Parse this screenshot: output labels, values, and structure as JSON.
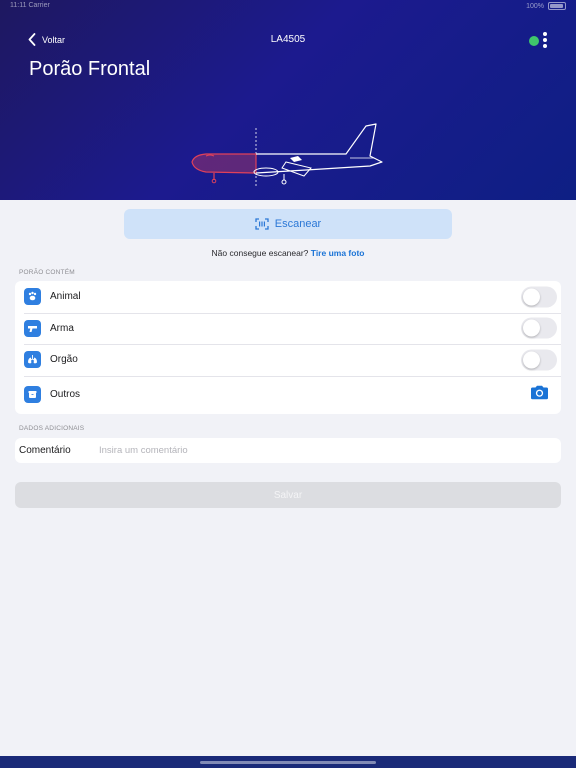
{
  "statusbar": {
    "time": "11:11",
    "carrier": "Carrier",
    "battery": "100%"
  },
  "header": {
    "back_label": "Voltar",
    "flight_number": "LA4505",
    "page_title": "Porão Frontal"
  },
  "scan": {
    "button_label": "Escanear",
    "prompt_text": "Não consegue escanear?",
    "photo_link": "Tire uma foto"
  },
  "hold_contents": {
    "section_label": "PORÃO CONTÉM",
    "items": [
      {
        "label": "Animal",
        "icon": "paw-icon",
        "control": "toggle",
        "checked": false
      },
      {
        "label": "Arma",
        "icon": "gun-icon",
        "control": "toggle",
        "checked": false
      },
      {
        "label": "Orgão",
        "icon": "lungs-icon",
        "control": "toggle",
        "checked": false
      },
      {
        "label": "Outros",
        "icon": "box-icon",
        "control": "camera"
      }
    ]
  },
  "additional": {
    "section_label": "DADOS ADICIONAIS",
    "comment_label": "Comentário",
    "comment_placeholder": "Insira um comentário",
    "comment_value": ""
  },
  "save_label": "Salvar",
  "colors": {
    "header_start": "#1e1860",
    "header_end": "#0e1f84",
    "accent": "#2f7fe0",
    "status_online": "#3fc66b",
    "front_hold_highlight": "#e0415a"
  }
}
